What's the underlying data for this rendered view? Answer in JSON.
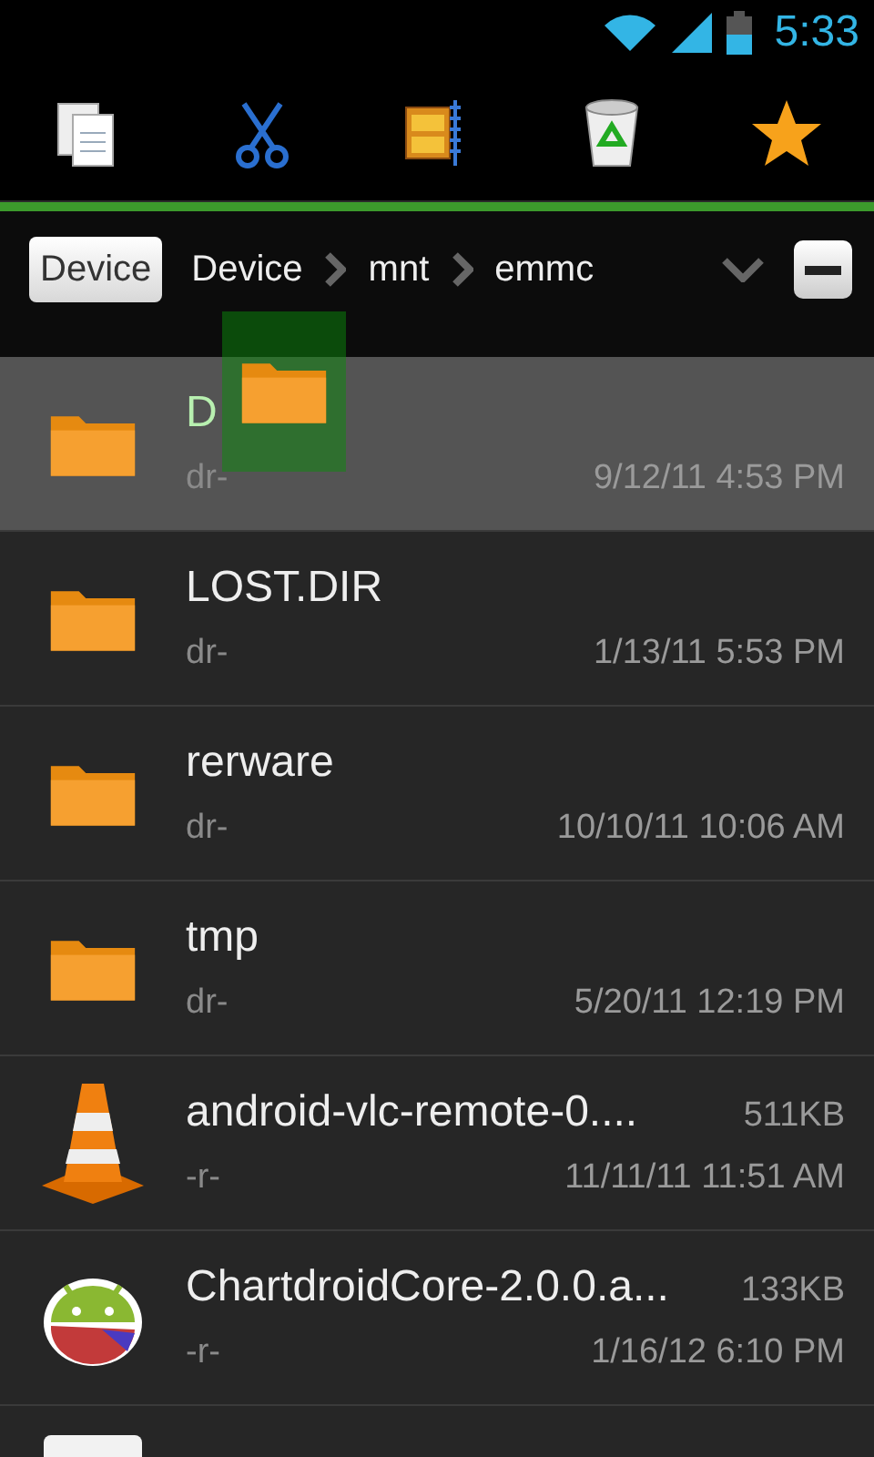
{
  "status_bar": {
    "time": "5:33"
  },
  "drag_preview": true,
  "breadcrumb": {
    "root_button": "Device",
    "path": [
      "Device",
      "mnt",
      "emmc"
    ]
  },
  "files": [
    {
      "kind": "folder",
      "name": "D",
      "perms": "dr-",
      "date": "9/12/11 4:53 PM",
      "selected": true
    },
    {
      "kind": "folder",
      "name": "LOST.DIR",
      "perms": "dr-",
      "date": "1/13/11 5:53 PM",
      "selected": false
    },
    {
      "kind": "folder",
      "name": "rerware",
      "perms": "dr-",
      "date": "10/10/11 10:06 AM",
      "selected": false
    },
    {
      "kind": "folder",
      "name": "tmp",
      "perms": "dr-",
      "date": "5/20/11 12:19 PM",
      "selected": false
    },
    {
      "kind": "cone",
      "name": "android-vlc-remote-0....",
      "perms": "-r-",
      "size": "511KB",
      "date": "11/11/11 11:51 AM",
      "selected": false
    },
    {
      "kind": "robot",
      "name": "ChartdroidCore-2.0.0.a...",
      "perms": "-r-",
      "size": "133KB",
      "date": "1/16/12 6:10 PM",
      "selected": false
    },
    {
      "kind": "document",
      "selected": false
    }
  ]
}
